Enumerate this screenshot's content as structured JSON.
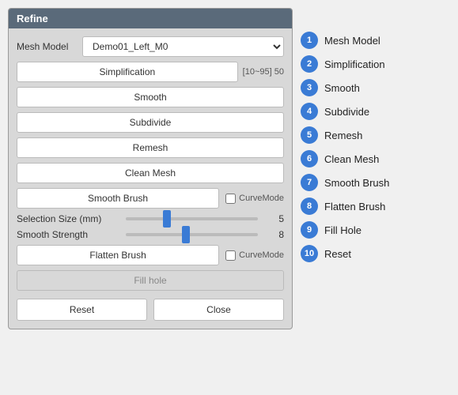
{
  "panel": {
    "title": "Refine",
    "mesh_model_label": "Mesh Model",
    "mesh_model_value": "Demo01_Left_M0",
    "simplification_label": "Simplification",
    "simplification_range": "[10~95]",
    "simplification_value": "50",
    "smooth_label": "Smooth",
    "subdivide_label": "Subdivide",
    "remesh_label": "Remesh",
    "clean_mesh_label": "Clean Mesh",
    "smooth_brush_label": "Smooth Brush",
    "curve_mode_1_label": "CurveMode",
    "selection_size_label": "Selection Size (mm)",
    "selection_size_value": "5",
    "smooth_strength_label": "Smooth Strength",
    "smooth_strength_value": "8",
    "flatten_brush_label": "Flatten Brush",
    "curve_mode_2_label": "CurveMode",
    "fill_hole_label": "Fill hole",
    "reset_label": "Reset",
    "close_label": "Close"
  },
  "legend": {
    "items": [
      {
        "number": "1",
        "label": "Mesh Model"
      },
      {
        "number": "2",
        "label": "Simplification"
      },
      {
        "number": "3",
        "label": "Smooth"
      },
      {
        "number": "4",
        "label": "Subdivide"
      },
      {
        "number": "5",
        "label": "Remesh"
      },
      {
        "number": "6",
        "label": "Clean Mesh"
      },
      {
        "number": "7",
        "label": "Smooth Brush"
      },
      {
        "number": "8",
        "label": "Flatten Brush"
      },
      {
        "number": "9",
        "label": "Fill Hole"
      },
      {
        "number": "10",
        "label": "Reset"
      }
    ]
  },
  "colors": {
    "accent": "#3a7bd5",
    "panel_bg": "#d8d8d8",
    "title_bg": "#5a6a7a"
  }
}
